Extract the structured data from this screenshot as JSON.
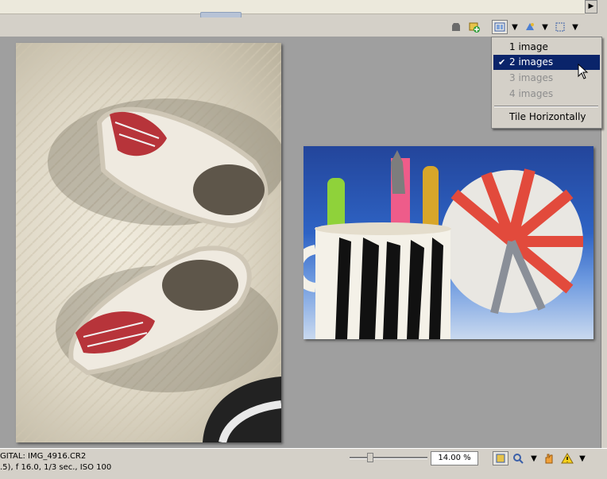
{
  "toolbar": {
    "tile_dropdown_icon": "tile-icon",
    "icons": [
      "stamp-icon",
      "add-image-icon",
      "tile-icon",
      "dropdown-arrow-icon",
      "color-icon",
      "selection-icon"
    ]
  },
  "menu": {
    "items": [
      {
        "label": "1 image",
        "enabled": true,
        "checked": false,
        "highlighted": false
      },
      {
        "label": "2 images",
        "enabled": true,
        "checked": true,
        "highlighted": true
      },
      {
        "label": "3 images",
        "enabled": false,
        "checked": false,
        "highlighted": false
      },
      {
        "label": "4 images",
        "enabled": false,
        "checked": false,
        "highlighted": false
      }
    ],
    "after_separator": "Tile Horizontally",
    "check_mark": "✔"
  },
  "status": {
    "line1": "GITAL:  IMG_4916.CR2",
    "line2": ".5), f 16.0, 1/3 sec., ISO 100",
    "zoom": "14.00 %"
  },
  "colors": {
    "menu_highlight": "#0a246a",
    "canvas": "#9f9f9f"
  }
}
